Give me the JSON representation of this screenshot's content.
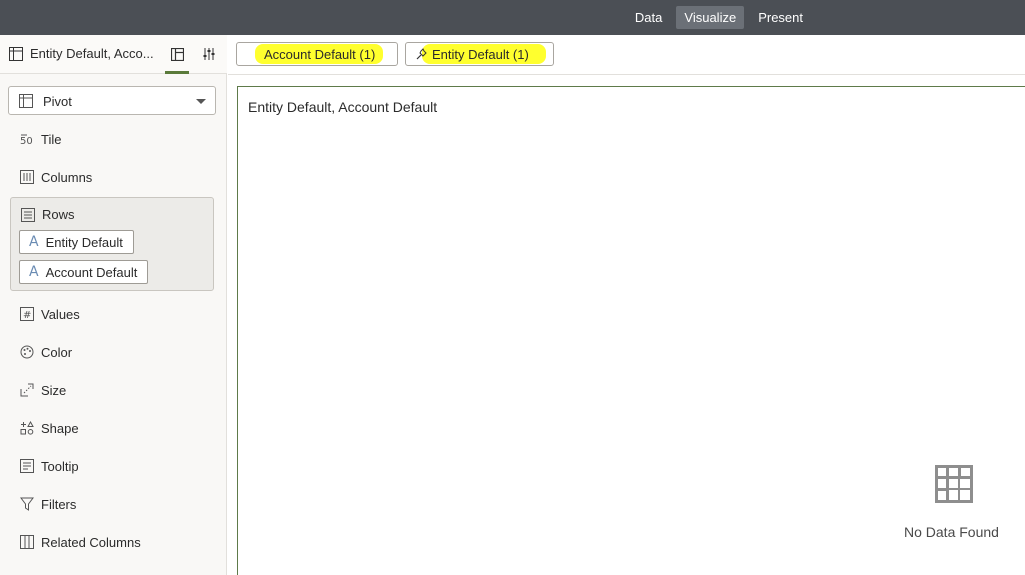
{
  "topnav": {
    "tabs": [
      {
        "label": "Data"
      },
      {
        "label": "Visualize"
      },
      {
        "label": "Present"
      }
    ]
  },
  "left_panel": {
    "datasource_title": "Entity Default, Acco...",
    "viz_type": "Pivot",
    "grammar": {
      "tile": "Tile",
      "columns": "Columns",
      "rows": "Rows",
      "values": "Values",
      "color": "Color",
      "size": "Size",
      "shape": "Shape",
      "tooltip": "Tooltip",
      "filters": "Filters",
      "related_columns": "Related Columns"
    },
    "row_fields": [
      "Entity Default",
      "Account Default"
    ]
  },
  "filter_bar": {
    "chips": [
      "Account Default (1)",
      "Entity Default (1)"
    ],
    "highlight_color": "#ffff2e"
  },
  "canvas": {
    "viz_title": "Entity Default, Account Default",
    "empty_message": "No Data Found"
  },
  "colors": {
    "topbar": "#4b4f55",
    "accent": "#5a7a3a"
  }
}
